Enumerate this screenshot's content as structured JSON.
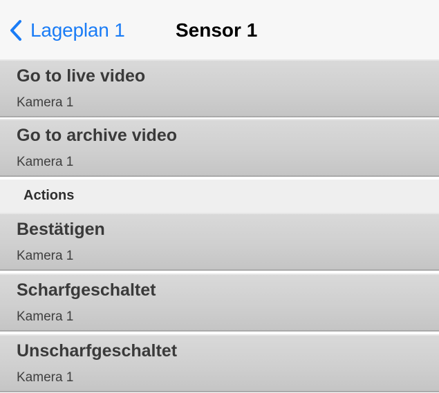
{
  "navbar": {
    "back_label": "Lageplan 1",
    "title": "Sensor 1",
    "accent_color": "#1a7cf6"
  },
  "video_rows": [
    {
      "title": "Go to live video",
      "subtitle": "Kamera 1"
    },
    {
      "title": "Go to archive video",
      "subtitle": "Kamera 1"
    }
  ],
  "actions_section": {
    "header": "Actions",
    "items": [
      {
        "title": "Bestätigen",
        "subtitle": "Kamera 1"
      },
      {
        "title": "Scharfgeschaltet",
        "subtitle": "Kamera 1"
      },
      {
        "title": "Unscharfgeschaltet",
        "subtitle": "Kamera 1"
      }
    ]
  },
  "icons": {
    "back": "chevron-left-icon"
  }
}
